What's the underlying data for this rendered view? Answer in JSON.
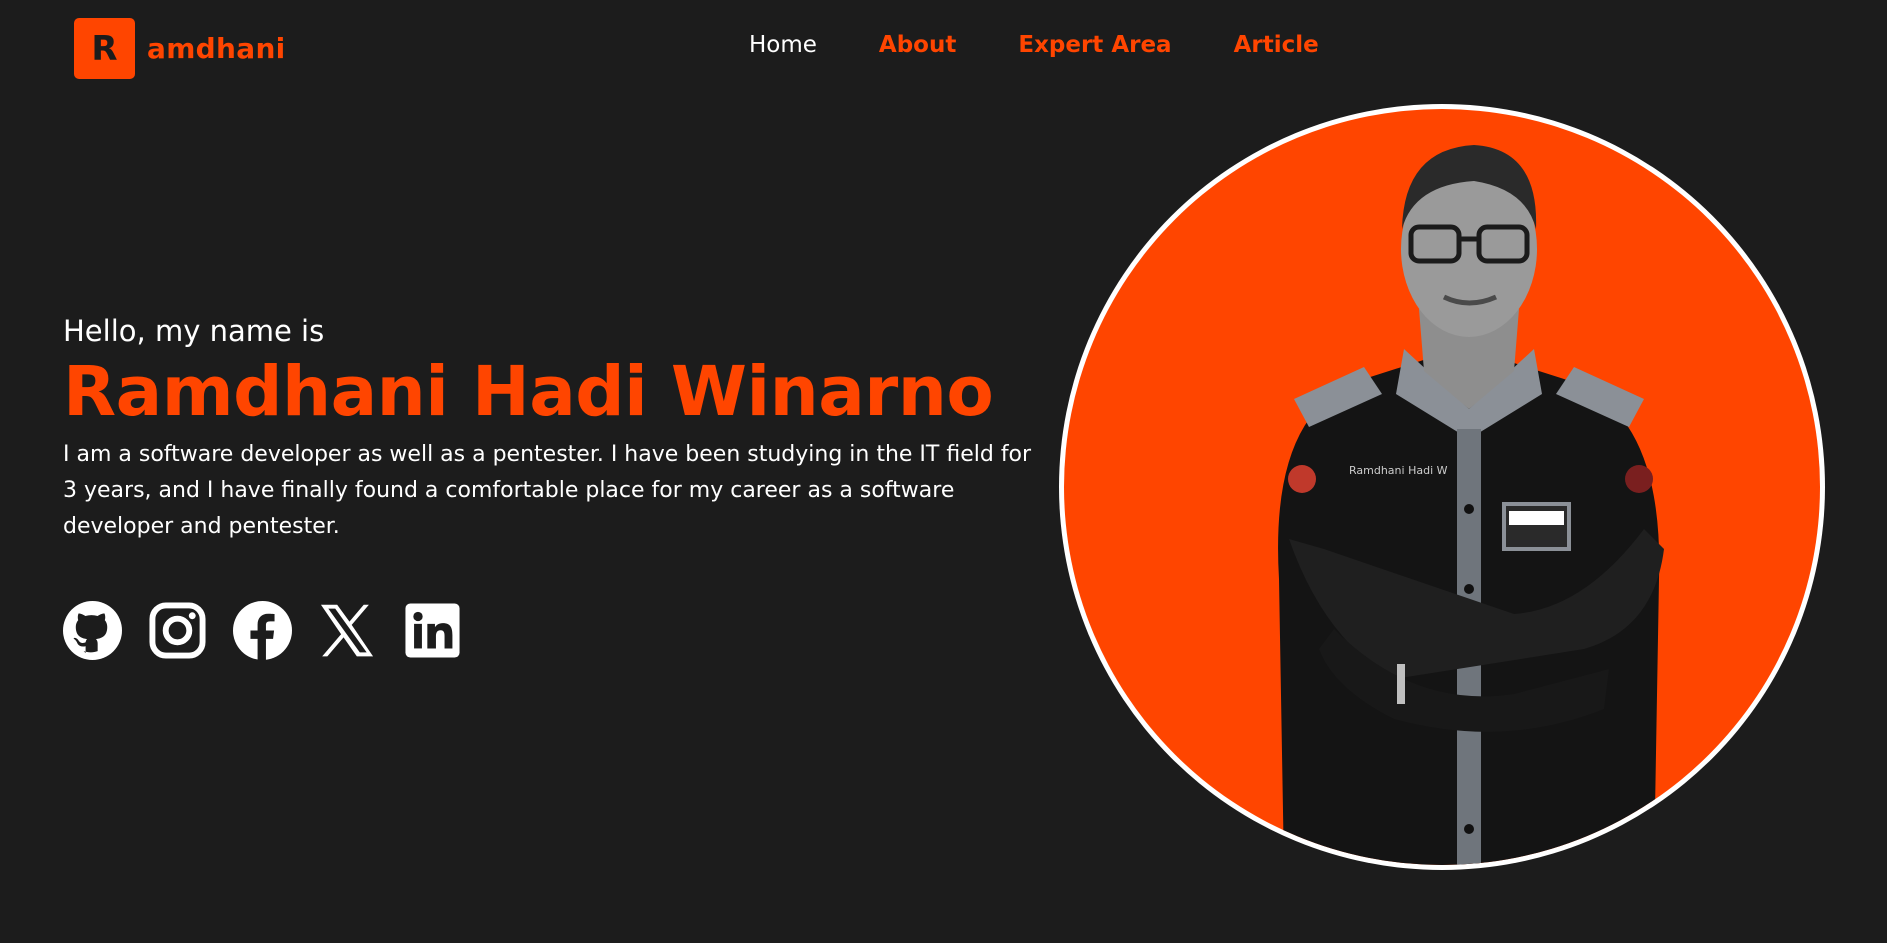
{
  "brand": {
    "badge": "R",
    "name": "amdhani"
  },
  "nav": {
    "items": [
      {
        "label": "Home",
        "active": true
      },
      {
        "label": "About",
        "active": false
      },
      {
        "label": "Expert Area",
        "active": false
      },
      {
        "label": "Article",
        "active": false
      }
    ]
  },
  "hero": {
    "greeting": "Hello, my name is",
    "name": "Ramdhani Hadi Winarno",
    "bio": "I am a software developer as well as a pentester. I have been studying in the IT field for 3 years, and I have finally found a comfortable place for my career as a software developer and pentester."
  },
  "socials": [
    {
      "icon": "github-icon"
    },
    {
      "icon": "instagram-icon"
    },
    {
      "icon": "facebook-icon"
    },
    {
      "icon": "x-icon"
    },
    {
      "icon": "linkedin-icon"
    }
  ],
  "portrait": {
    "shirt_name_tag": "Ramdhani Hadi W"
  },
  "colors": {
    "background": "#1c1c1c",
    "accent": "#ff4500",
    "text": "#ffffff"
  }
}
